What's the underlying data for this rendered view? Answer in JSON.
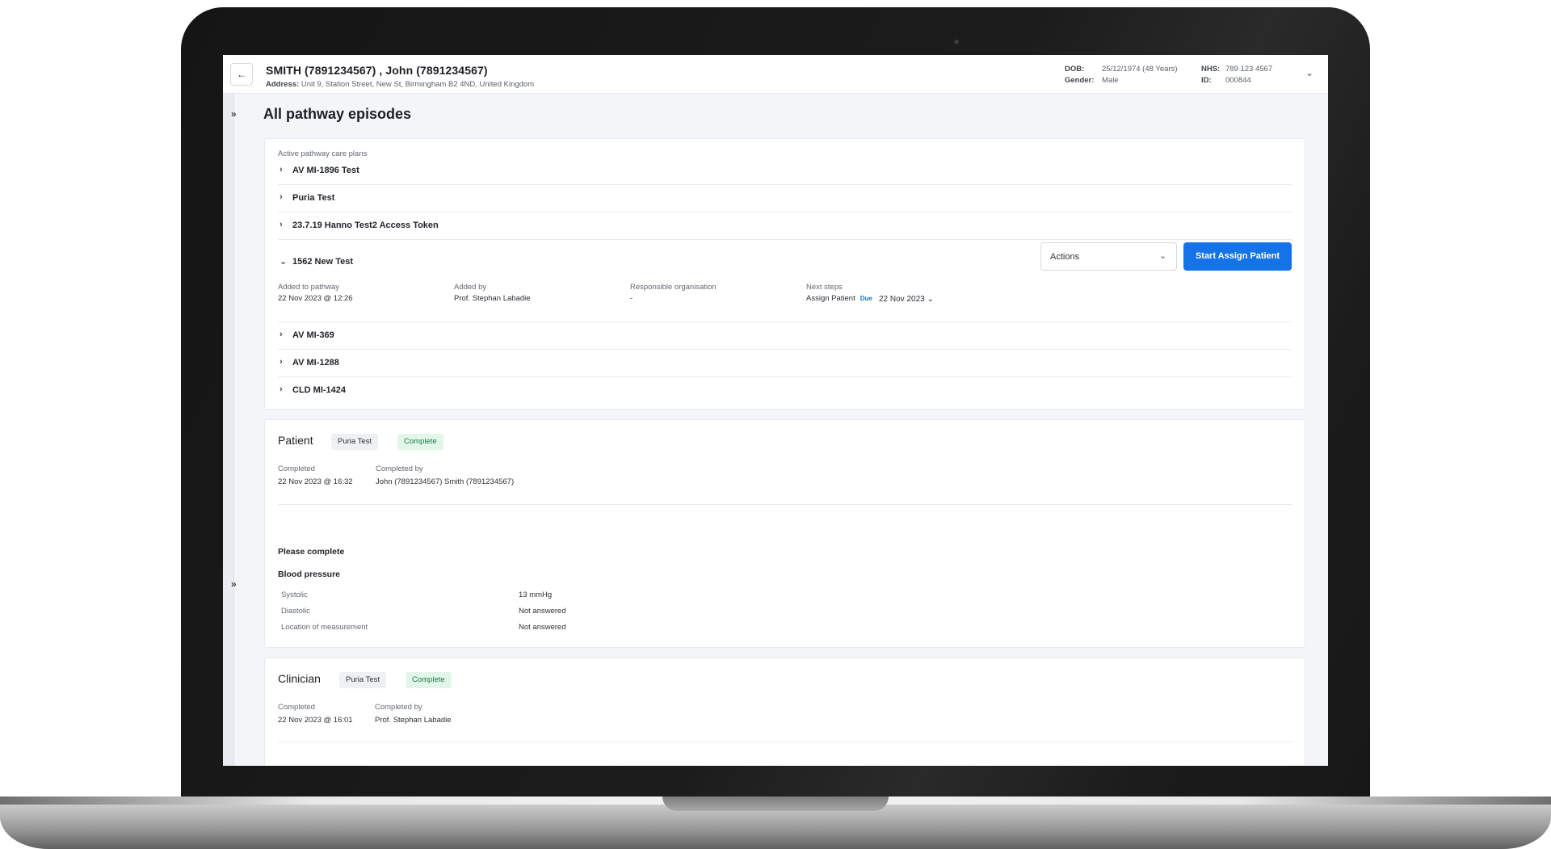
{
  "header": {
    "back_icon": "←",
    "patient_name": "SMITH (7891234567) , John (7891234567)",
    "address_label": "Address:",
    "address_value": "Unit 9, Station Street, New St, Birmingham B2 4ND, United Kingdom",
    "dob_label": "DOB:",
    "dob_value": "25/12/1974 (48 Years)",
    "gender_label": "Gender:",
    "gender_value": "Male",
    "nhs_label": "NHS:",
    "nhs_value": "789 123 4567",
    "id_label": "ID:",
    "id_value": "000844",
    "expand_icon": "⌄"
  },
  "sidebar": {
    "expand_icon": "»"
  },
  "page": {
    "title": "All pathway episodes"
  },
  "care_plans": {
    "section_label": "Active pathway care plans",
    "items_before": [
      {
        "label": "AV MI-1896 Test"
      },
      {
        "label": "Puria Test"
      },
      {
        "label": "23.7.19 Hanno Test2 Access Token"
      }
    ],
    "expanded": {
      "label": "1562 New Test",
      "actions_label": "Actions",
      "start_button": "Start Assign Patient",
      "added_to_pathway_label": "Added to pathway",
      "added_to_pathway_value": "22 Nov 2023 @ 12:26",
      "added_by_label": "Added by",
      "added_by_value": "Prof. Stephan Labadie",
      "responsible_org_label": "Responsible organisation",
      "responsible_org_value": "-",
      "next_steps_label": "Next steps",
      "next_steps_value": "Assign Patient",
      "due_badge": "Due",
      "due_date": "22 Nov 2023"
    },
    "items_after": [
      {
        "label": "AV MI-369"
      },
      {
        "label": "AV MI-1288"
      },
      {
        "label": "CLD MI-1424"
      }
    ]
  },
  "patient_section": {
    "title": "Patient",
    "tag": "Puria Test",
    "status": "Complete",
    "completed_label": "Completed",
    "completed_value": "22 Nov 2023 @ 16:32",
    "completed_by_label": "Completed by",
    "completed_by_value": "John (7891234567)  Smith (7891234567)",
    "please_complete": "Please complete",
    "bp_title": "Blood pressure",
    "bp_rows": [
      {
        "label": "Systolic",
        "value": "13 mmHg"
      },
      {
        "label": "Diastolic",
        "value": "Not answered"
      },
      {
        "label": "Location of measurement",
        "value": "Not answered"
      }
    ]
  },
  "clinician_section": {
    "title": "Clinician",
    "tag": "Puria Test",
    "status": "Complete",
    "completed_label": "Completed",
    "completed_value": "22 Nov 2023 @ 16:01",
    "completed_by_label": "Completed by",
    "completed_by_value": "Prof. Stephan Labadie"
  }
}
